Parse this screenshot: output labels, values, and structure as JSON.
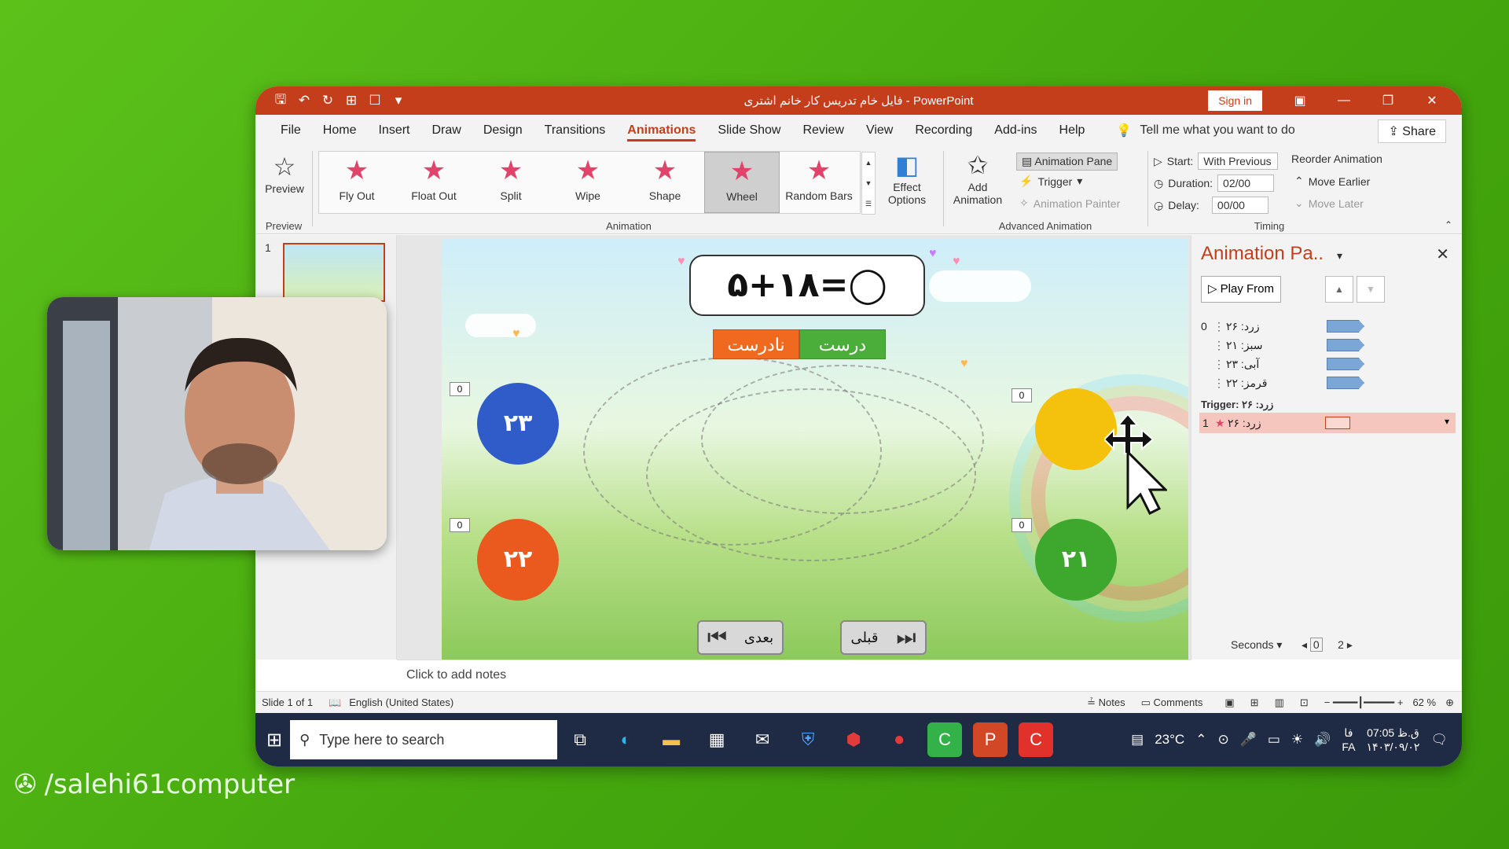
{
  "window": {
    "title": "فایل خام تدریس کار خانم اشتری  -  PowerPoint",
    "signin": "Sign in",
    "share": "Share"
  },
  "menu": {
    "tabs": [
      "File",
      "Home",
      "Insert",
      "Draw",
      "Design",
      "Transitions",
      "Animations",
      "Slide Show",
      "Review",
      "View",
      "Recording",
      "Add-ins",
      "Help"
    ],
    "tellme": "Tell me what you want to do"
  },
  "ribbon": {
    "preview": "Preview",
    "preview_group": "Preview",
    "effects": [
      "Fly Out",
      "Float Out",
      "Split",
      "Wipe",
      "Shape",
      "Wheel",
      "Random Bars"
    ],
    "effect_options": "Effect Options",
    "animation_group": "Animation",
    "add_animation": "Add Animation",
    "animation_pane": "Animation Pane",
    "trigger": "Trigger",
    "animation_painter": "Animation Painter",
    "advanced_group": "Advanced Animation",
    "start_label": "Start:",
    "start_value": "With Previous",
    "duration_label": "Duration:",
    "duration_value": "02/00",
    "delay_label": "Delay:",
    "delay_value": "00/00",
    "reorder": "Reorder Animation",
    "move_earlier": "Move Earlier",
    "move_later": "Move Later",
    "timing_group": "Timing"
  },
  "thumbs": {
    "number": "1"
  },
  "slide": {
    "equation": "۵+۱۸=◯",
    "correct": "درست",
    "wrong": "نادرست",
    "balls": {
      "blue": "۲۳",
      "orange": "۲۲",
      "green": "۲۱"
    },
    "counters": [
      "0",
      "0",
      "0",
      "0"
    ],
    "next": "بعدی",
    "prev": "قبلی"
  },
  "anim_pane": {
    "title": "Animation Pa..",
    "play_from": "Play From",
    "items": [
      {
        "num": "0",
        "name": "زرد: ۲۶"
      },
      {
        "num": "",
        "name": "سبز: ۲۱"
      },
      {
        "num": "",
        "name": "آبی: ۲۳"
      },
      {
        "num": "",
        "name": "قرمز: ۲۲"
      }
    ],
    "trigger": "Trigger: زرد: ۲۶",
    "selected": {
      "num": "1",
      "name": "زرد: ۲۶"
    },
    "seconds": "Seconds",
    "scale": [
      "0",
      "2"
    ]
  },
  "notes": {
    "placeholder": "Click to add notes"
  },
  "status": {
    "slide": "Slide 1 of 1",
    "language": "English (United States)",
    "notes": "Notes",
    "comments": "Comments",
    "zoom": "62 %"
  },
  "taskbar": {
    "search": "Type here to search",
    "temp": "23°C",
    "lang": "FA",
    "lang2": "فا",
    "time": "07:05 ق.ظ",
    "date": "۱۴۰۳/۰۹/۰۲"
  },
  "watermark": "/salehi61computer",
  "colors": {
    "accent": "#c43e1c",
    "background": "#4cb012"
  }
}
